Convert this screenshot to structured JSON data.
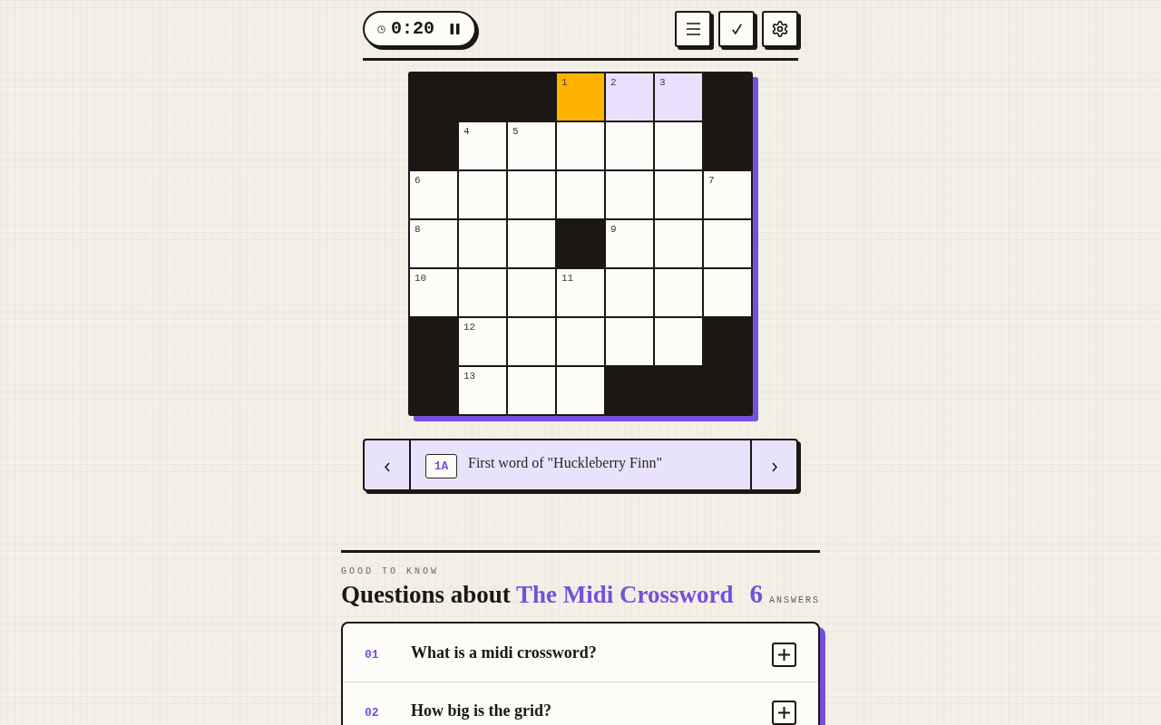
{
  "timer": {
    "time": "0:20"
  },
  "grid": {
    "rows": [
      {
        "cells": [
          {
            "kind": "block"
          },
          {
            "kind": "block"
          },
          {
            "kind": "block"
          },
          {
            "kind": "square",
            "number": "1",
            "selected": true,
            "highlighted": false
          },
          {
            "kind": "square",
            "number": "2",
            "selected": false,
            "highlighted": true
          },
          {
            "kind": "square",
            "number": "3",
            "selected": false,
            "highlighted": true
          },
          {
            "kind": "block"
          }
        ]
      },
      {
        "cells": [
          {
            "kind": "block"
          },
          {
            "kind": "square",
            "number": "4",
            "selected": false,
            "highlighted": false
          },
          {
            "kind": "square",
            "number": "5",
            "selected": false,
            "highlighted": false
          },
          {
            "kind": "square",
            "selected": false,
            "highlighted": false
          },
          {
            "kind": "square",
            "selected": false,
            "highlighted": false
          },
          {
            "kind": "square",
            "selected": false,
            "highlighted": false
          },
          {
            "kind": "block"
          }
        ]
      },
      {
        "cells": [
          {
            "kind": "square",
            "number": "6",
            "selected": false,
            "highlighted": false
          },
          {
            "kind": "square",
            "selected": false,
            "highlighted": false
          },
          {
            "kind": "square",
            "selected": false,
            "highlighted": false
          },
          {
            "kind": "square",
            "selected": false,
            "highlighted": false
          },
          {
            "kind": "square",
            "selected": false,
            "highlighted": false
          },
          {
            "kind": "square",
            "selected": false,
            "highlighted": false
          },
          {
            "kind": "square",
            "number": "7",
            "selected": false,
            "highlighted": false
          }
        ]
      },
      {
        "cells": [
          {
            "kind": "square",
            "number": "8",
            "selected": false,
            "highlighted": false
          },
          {
            "kind": "square",
            "selected": false,
            "highlighted": false
          },
          {
            "kind": "square",
            "selected": false,
            "highlighted": false
          },
          {
            "kind": "block"
          },
          {
            "kind": "square",
            "number": "9",
            "selected": false,
            "highlighted": false
          },
          {
            "kind": "square",
            "selected": false,
            "highlighted": false
          },
          {
            "kind": "square",
            "selected": false,
            "highlighted": false
          }
        ]
      },
      {
        "cells": [
          {
            "kind": "square",
            "number": "10",
            "selected": false,
            "highlighted": false
          },
          {
            "kind": "square",
            "selected": false,
            "highlighted": false
          },
          {
            "kind": "square",
            "selected": false,
            "highlighted": false
          },
          {
            "kind": "square",
            "number": "11",
            "selected": false,
            "highlighted": false
          },
          {
            "kind": "square",
            "selected": false,
            "highlighted": false
          },
          {
            "kind": "square",
            "selected": false,
            "highlighted": false
          },
          {
            "kind": "square",
            "selected": false,
            "highlighted": false
          }
        ]
      },
      {
        "cells": [
          {
            "kind": "block"
          },
          {
            "kind": "square",
            "number": "12",
            "selected": false,
            "highlighted": false
          },
          {
            "kind": "square",
            "selected": false,
            "highlighted": false
          },
          {
            "kind": "square",
            "selected": false,
            "highlighted": false
          },
          {
            "kind": "square",
            "selected": false,
            "highlighted": false
          },
          {
            "kind": "square",
            "selected": false,
            "highlighted": false
          },
          {
            "kind": "block"
          }
        ]
      },
      {
        "cells": [
          {
            "kind": "block"
          },
          {
            "kind": "square",
            "number": "13",
            "selected": false,
            "highlighted": false
          },
          {
            "kind": "square",
            "selected": false,
            "highlighted": false
          },
          {
            "kind": "square",
            "selected": false,
            "highlighted": false
          },
          {
            "kind": "block"
          },
          {
            "kind": "block"
          },
          {
            "kind": "block"
          }
        ]
      }
    ]
  },
  "clue": {
    "label": "1A",
    "text": "First word of \"Huckleberry Finn\""
  },
  "faq": {
    "eyebrow": "GOOD TO KNOW",
    "title": "Questions about",
    "title_highlight": "The Midi Crossword",
    "count": "6",
    "count_label": "ANSWERS",
    "items": [
      {
        "number": "01",
        "question": "What is a midi crossword?",
        "expanded": false
      },
      {
        "number": "02",
        "question": "How big is the grid?",
        "expanded": false
      }
    ]
  }
}
